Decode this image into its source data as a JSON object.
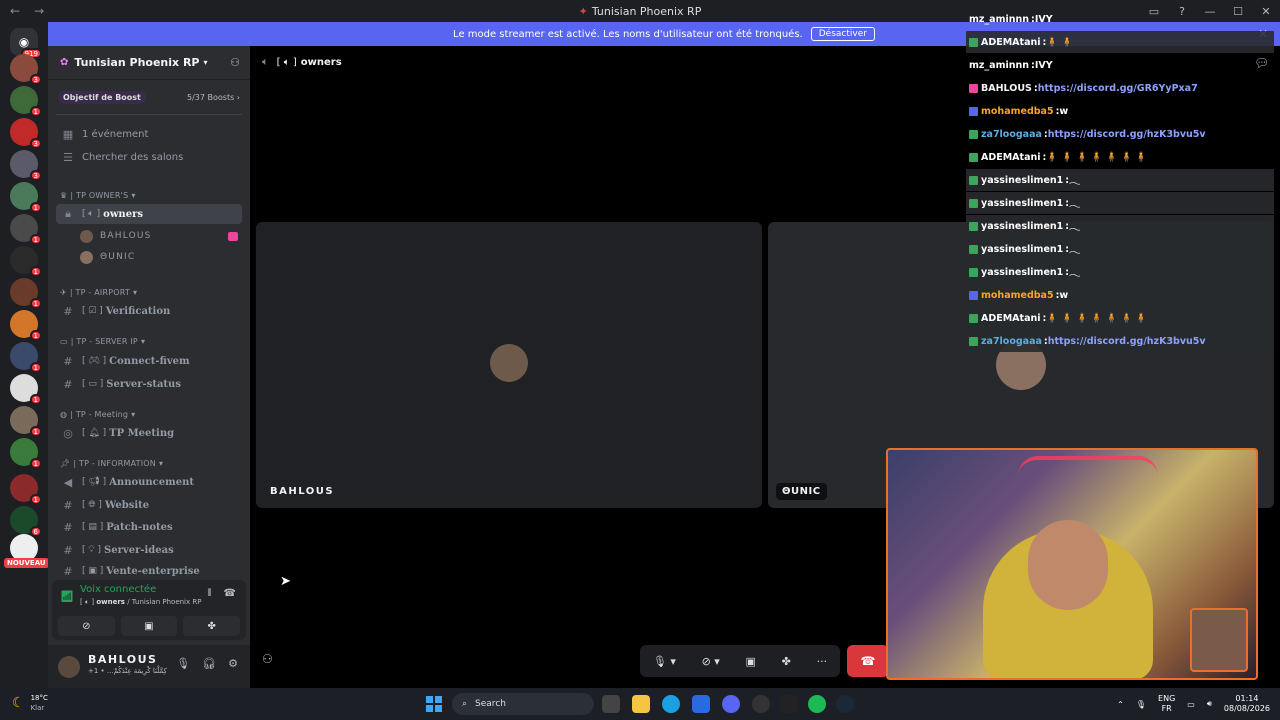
{
  "window": {
    "title": "Tunisian Phoenix RP"
  },
  "banner": {
    "text": "Le mode streamer est activé. Les noms d'utilisateur ont été tronqués.",
    "button": "Désactiver"
  },
  "rail": {
    "home_badge": "919",
    "badges": [
      "3",
      "1",
      "3",
      "3",
      "1",
      "1",
      "1",
      "1",
      "1",
      "1",
      "1",
      "1",
      "1",
      "1",
      "6"
    ],
    "new_label": "NOUVEAU"
  },
  "guild": {
    "name": "Tunisian Phoenix RP",
    "boost_label": "Objectif de Boost",
    "boost_count": "5/37 Boosts",
    "events": "1 événement",
    "browse": "Chercher des salons"
  },
  "categories": {
    "owners": "| TP OWNER'S",
    "airport": "| TP - AIRPORT",
    "serverip": "| TP - SERVER IP",
    "meeting": "| TP - Meeting",
    "information": "| TP - INFORMATION"
  },
  "channels": {
    "owners": "owners",
    "verification": "Verification",
    "connect": "Connect-fivem",
    "status": "Server-status",
    "meeting": "TP Meeting",
    "announcement": "Announcement",
    "website": "Website",
    "patch": "Patch-notes",
    "ideas": "Server-ideas",
    "vente": "Vente-enterprise"
  },
  "members": [
    "BAHLOUS",
    "ΘUNIC"
  ],
  "voice": {
    "status": "Voix connectée",
    "channel": "owners",
    "server": "/ Tunisian Phoenix RP"
  },
  "user": {
    "name": "BAHLOUS",
    "status": "+1 • ...كِمَّلْنَا كْرِيمَة عِنْدَكُمْ"
  },
  "main": {
    "channel": "owners"
  },
  "tiles": {
    "left_name": "BAHLOUS",
    "right_name": "ΘUNIC"
  },
  "chat": [
    {
      "name": "mz_aminnn",
      "text": "IVY",
      "color": "#ffffff"
    },
    {
      "name": "ADEMAtani",
      "text": "🧍🧍",
      "color": "#ffffff",
      "shaded": true
    },
    {
      "name": "mz_aminnn",
      "text": "IVY",
      "color": "#ffffff"
    },
    {
      "name": "BAHLOUS",
      "text": "https://discord.gg/GR6YyPxa7",
      "color": "#f2f3f5"
    },
    {
      "name": "mohamedba5",
      "text": "w",
      "color": "#f5a623"
    },
    {
      "name": "za7loogaaa",
      "text": "https://discord.gg/hzK3bvu5v",
      "color": "#5dade2"
    },
    {
      "name": "ADEMAtani",
      "text": "🧍🧍🧍🧍🧍🧍🧍",
      "color": "#ffffff"
    },
    {
      "name": "yassineslimen1",
      "text": "𓂃",
      "color": "#ffffff",
      "shaded": true
    },
    {
      "name": "yassineslimen1",
      "text": "𓂃",
      "color": "#ffffff",
      "shaded": true
    },
    {
      "name": "yassineslimen1",
      "text": "𓂃",
      "color": "#ffffff",
      "shaded": true
    },
    {
      "name": "yassineslimen1",
      "text": "𓂃",
      "color": "#ffffff",
      "shaded": true
    },
    {
      "name": "yassineslimen1",
      "text": "𓂃",
      "color": "#ffffff",
      "shaded": true
    },
    {
      "name": "mohamedba5",
      "text": "w",
      "color": "#f5a623",
      "shaded": true
    },
    {
      "name": "ADEMAtani",
      "text": "🧍🧍🧍🧍🧍🧍🧍",
      "color": "#ffffff",
      "shaded": true
    },
    {
      "name": "za7loogaaa",
      "text": "https://discord.gg/hzK3bvu5v",
      "color": "#5dade2",
      "shaded": true
    }
  ],
  "taskbar": {
    "temp": "18°C",
    "weather": "Klar",
    "search": "Search",
    "lang1": "ENG",
    "lang2": "FR",
    "time": "01:14",
    "date": "08/08/2026"
  },
  "colors": {
    "accent": "#5865f2",
    "hangup": "#da373c",
    "connected": "#23a55a",
    "webcam_frame": "#e8702a"
  }
}
